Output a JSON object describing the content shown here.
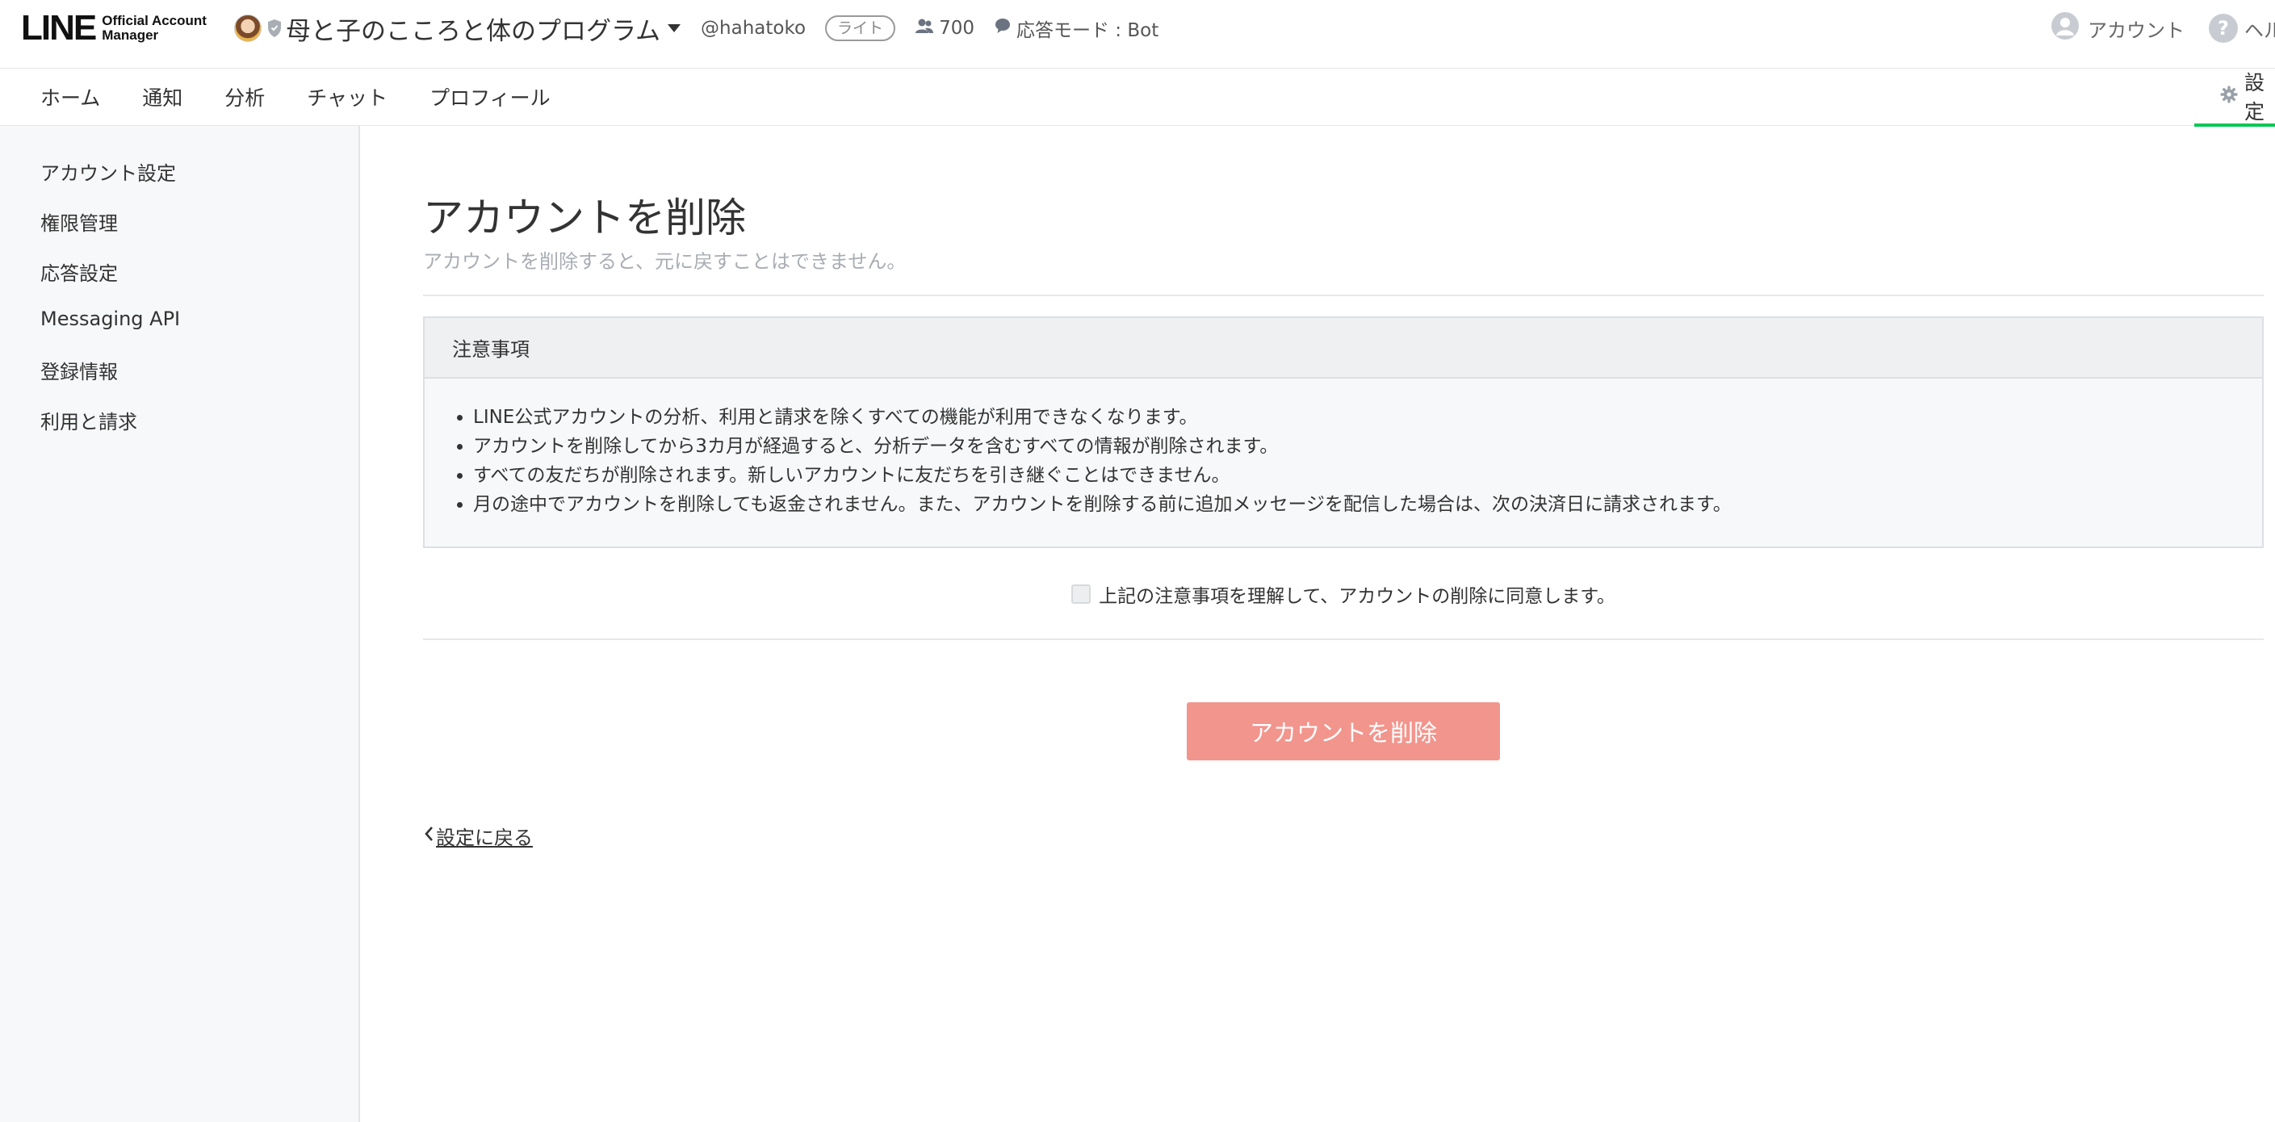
{
  "header": {
    "logo_text": "LINE",
    "logo_sub_line1": "Official Account",
    "logo_sub_line2": "Manager",
    "account_name": "母と子のこころと体のプログラム",
    "account_id": "@hahatoko",
    "plan_badge": "ライト",
    "friends_count": "700",
    "response_mode": "応答モード : Bot",
    "account_link": "アカウント",
    "help_link": "ヘル"
  },
  "nav": {
    "tabs": [
      "ホーム",
      "通知",
      "分析",
      "チャット",
      "プロフィール"
    ],
    "settings": "設定",
    "active_color": "#06c755"
  },
  "sidebar": {
    "items": [
      "アカウント設定",
      "権限管理",
      "応答設定",
      "Messaging API",
      "登録情報",
      "利用と請求"
    ]
  },
  "main": {
    "title": "アカウントを削除",
    "subtitle": "アカウントを削除すると、元に戻すことはできません。",
    "notice_title": "注意事項",
    "notice_items": [
      "LINE公式アカウントの分析、利用と請求を除くすべての機能が利用できなくなります。",
      "アカウントを削除してから3カ月が経過すると、分析データを含むすべての情報が削除されます。",
      "すべての友だちが削除されます。新しいアカウントに友だちを引き継ぐことはできません。",
      "月の途中でアカウントを削除しても返金されません。また、アカウントを削除する前に追加メッセージを配信した場合は、次の決済日に請求されます。"
    ],
    "agree_label": "上記の注意事項を理解して、アカウントの削除に同意します。",
    "agree_checked": false,
    "delete_button": "アカウントを削除",
    "delete_button_color": "#f2958d",
    "back_link": "設定に戻る"
  }
}
